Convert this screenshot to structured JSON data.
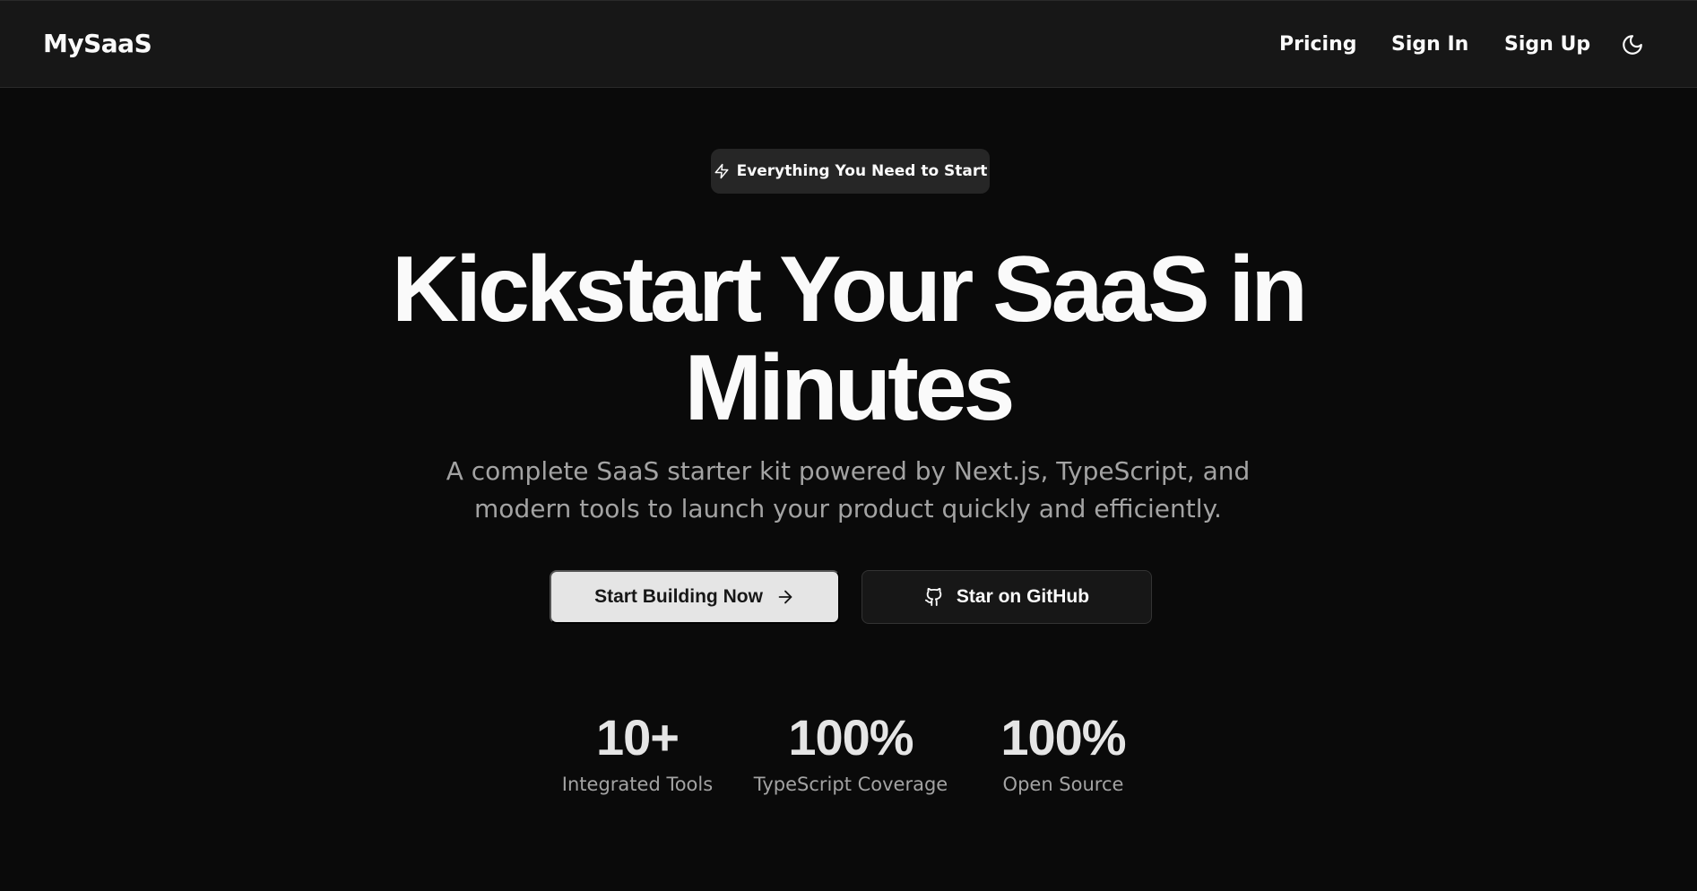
{
  "header": {
    "brand": "MySaaS",
    "nav": {
      "pricing": "Pricing",
      "sign_in": "Sign In",
      "sign_up": "Sign Up"
    },
    "theme_icon": "moon-icon"
  },
  "hero": {
    "badge_icon": "zap-icon",
    "badge_text": "Everything You Need to Start",
    "title_line1": "Kickstart Your SaaS in",
    "title_line2": "Minutes",
    "subtitle": "A complete SaaS starter kit powered by Next.js, TypeScript, and modern tools to launch your product quickly and efficiently.",
    "primary_button": "Start Building Now",
    "primary_icon": "arrow-right-icon",
    "secondary_button": "Star on GitHub",
    "secondary_icon": "github-icon"
  },
  "stats": [
    {
      "value": "10+",
      "label": "Integrated Tools"
    },
    {
      "value": "100%",
      "label": "TypeScript Coverage"
    },
    {
      "value": "100%",
      "label": "Open Source"
    }
  ],
  "colors": {
    "background": "#0a0a0a",
    "navbar": "#171717",
    "primary_button": "#e5e5e5",
    "muted_text": "#a3a3a3"
  }
}
